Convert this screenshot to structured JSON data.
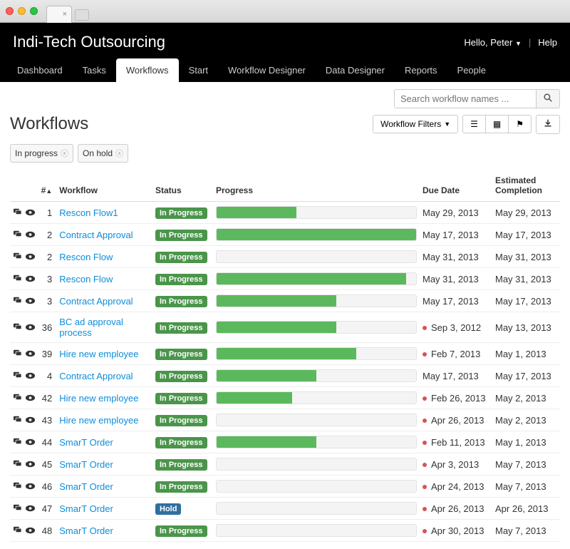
{
  "browser": {
    "tab_title": ""
  },
  "header": {
    "brand": "Indi-Tech Outsourcing",
    "greeting": "Hello, Peter",
    "help": "Help"
  },
  "nav": {
    "items": [
      "Dashboard",
      "Tasks",
      "Workflows",
      "Start",
      "Workflow Designer",
      "Data Designer",
      "Reports",
      "People"
    ],
    "active": "Workflows"
  },
  "search": {
    "placeholder": "Search workflow names ..."
  },
  "page": {
    "title": "Workflows",
    "filter_button": "Workflow Filters"
  },
  "filters": [
    "In progress",
    "On hold"
  ],
  "columns": {
    "num": "#",
    "workflow": "Workflow",
    "status": "Status",
    "progress": "Progress",
    "due": "Due Date",
    "est": "Estimated Completion"
  },
  "rows": [
    {
      "num": 1,
      "name": "Rescon Flow1",
      "status": "In Progress",
      "progress": 40,
      "due": "May 29, 2013",
      "est": "May 29, 2013",
      "overdue": false
    },
    {
      "num": 2,
      "name": "Contract Approval",
      "status": "In Progress",
      "progress": 100,
      "due": "May 17, 2013",
      "est": "May 17, 2013",
      "overdue": false
    },
    {
      "num": 2,
      "name": "Rescon Flow",
      "status": "In Progress",
      "progress": 0,
      "due": "May 31, 2013",
      "est": "May 31, 2013",
      "overdue": false
    },
    {
      "num": 3,
      "name": "Rescon Flow",
      "status": "In Progress",
      "progress": 95,
      "due": "May 31, 2013",
      "est": "May 31, 2013",
      "overdue": false
    },
    {
      "num": 3,
      "name": "Contract Approval",
      "status": "In Progress",
      "progress": 60,
      "due": "May 17, 2013",
      "est": "May 17, 2013",
      "overdue": false
    },
    {
      "num": 36,
      "name": "BC ad approval process",
      "status": "In Progress",
      "progress": 60,
      "due": "Sep 3, 2012",
      "est": "May 13, 2013",
      "overdue": true
    },
    {
      "num": 39,
      "name": "Hire new employee",
      "status": "In Progress",
      "progress": 70,
      "due": "Feb 7, 2013",
      "est": "May 1, 2013",
      "overdue": true
    },
    {
      "num": 4,
      "name": "Contract Approval",
      "status": "In Progress",
      "progress": 50,
      "due": "May 17, 2013",
      "est": "May 17, 2013",
      "overdue": false
    },
    {
      "num": 42,
      "name": "Hire new employee",
      "status": "In Progress",
      "progress": 38,
      "due": "Feb 26, 2013",
      "est": "May 2, 2013",
      "overdue": true
    },
    {
      "num": 43,
      "name": "Hire new employee",
      "status": "In Progress",
      "progress": 0,
      "due": "Apr 26, 2013",
      "est": "May 2, 2013",
      "overdue": true
    },
    {
      "num": 44,
      "name": "SmarT Order",
      "status": "In Progress",
      "progress": 50,
      "due": "Feb 11, 2013",
      "est": "May 1, 2013",
      "overdue": true
    },
    {
      "num": 45,
      "name": "SmarT Order",
      "status": "In Progress",
      "progress": 0,
      "due": "Apr 3, 2013",
      "est": "May 7, 2013",
      "overdue": true
    },
    {
      "num": 46,
      "name": "SmarT Order",
      "status": "In Progress",
      "progress": 0,
      "due": "Apr 24, 2013",
      "est": "May 7, 2013",
      "overdue": true
    },
    {
      "num": 47,
      "name": "SmarT Order",
      "status": "Hold",
      "progress": 0,
      "due": "Apr 26, 2013",
      "est": "Apr 26, 2013",
      "overdue": true
    },
    {
      "num": 48,
      "name": "SmarT Order",
      "status": "In Progress",
      "progress": 0,
      "due": "Apr 30, 2013",
      "est": "May 7, 2013",
      "overdue": true
    }
  ]
}
